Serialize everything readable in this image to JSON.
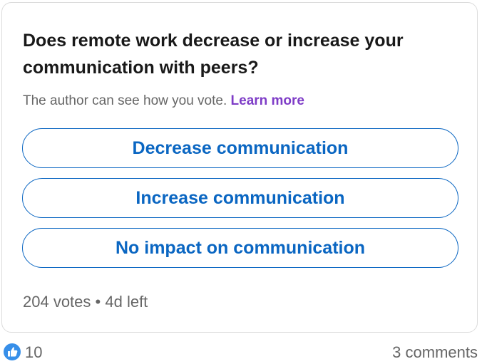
{
  "poll": {
    "question": "Does remote work decrease or increase your communication with peers?",
    "privacy_note": "The author can see how you vote.",
    "learn_more_label": "Learn more",
    "options": [
      {
        "label": "Decrease communication"
      },
      {
        "label": "Increase communication"
      },
      {
        "label": "No impact on communication"
      }
    ],
    "votes": "204 votes",
    "separator": "•",
    "time_left": "4d left"
  },
  "social": {
    "reaction_icon": "like-icon",
    "reaction_count": "10",
    "comments": "3 comments"
  },
  "colors": {
    "accent": "#0a66c2",
    "link": "#7e3cc7",
    "muted_text": "#666666",
    "border": "#dcdcdc"
  }
}
